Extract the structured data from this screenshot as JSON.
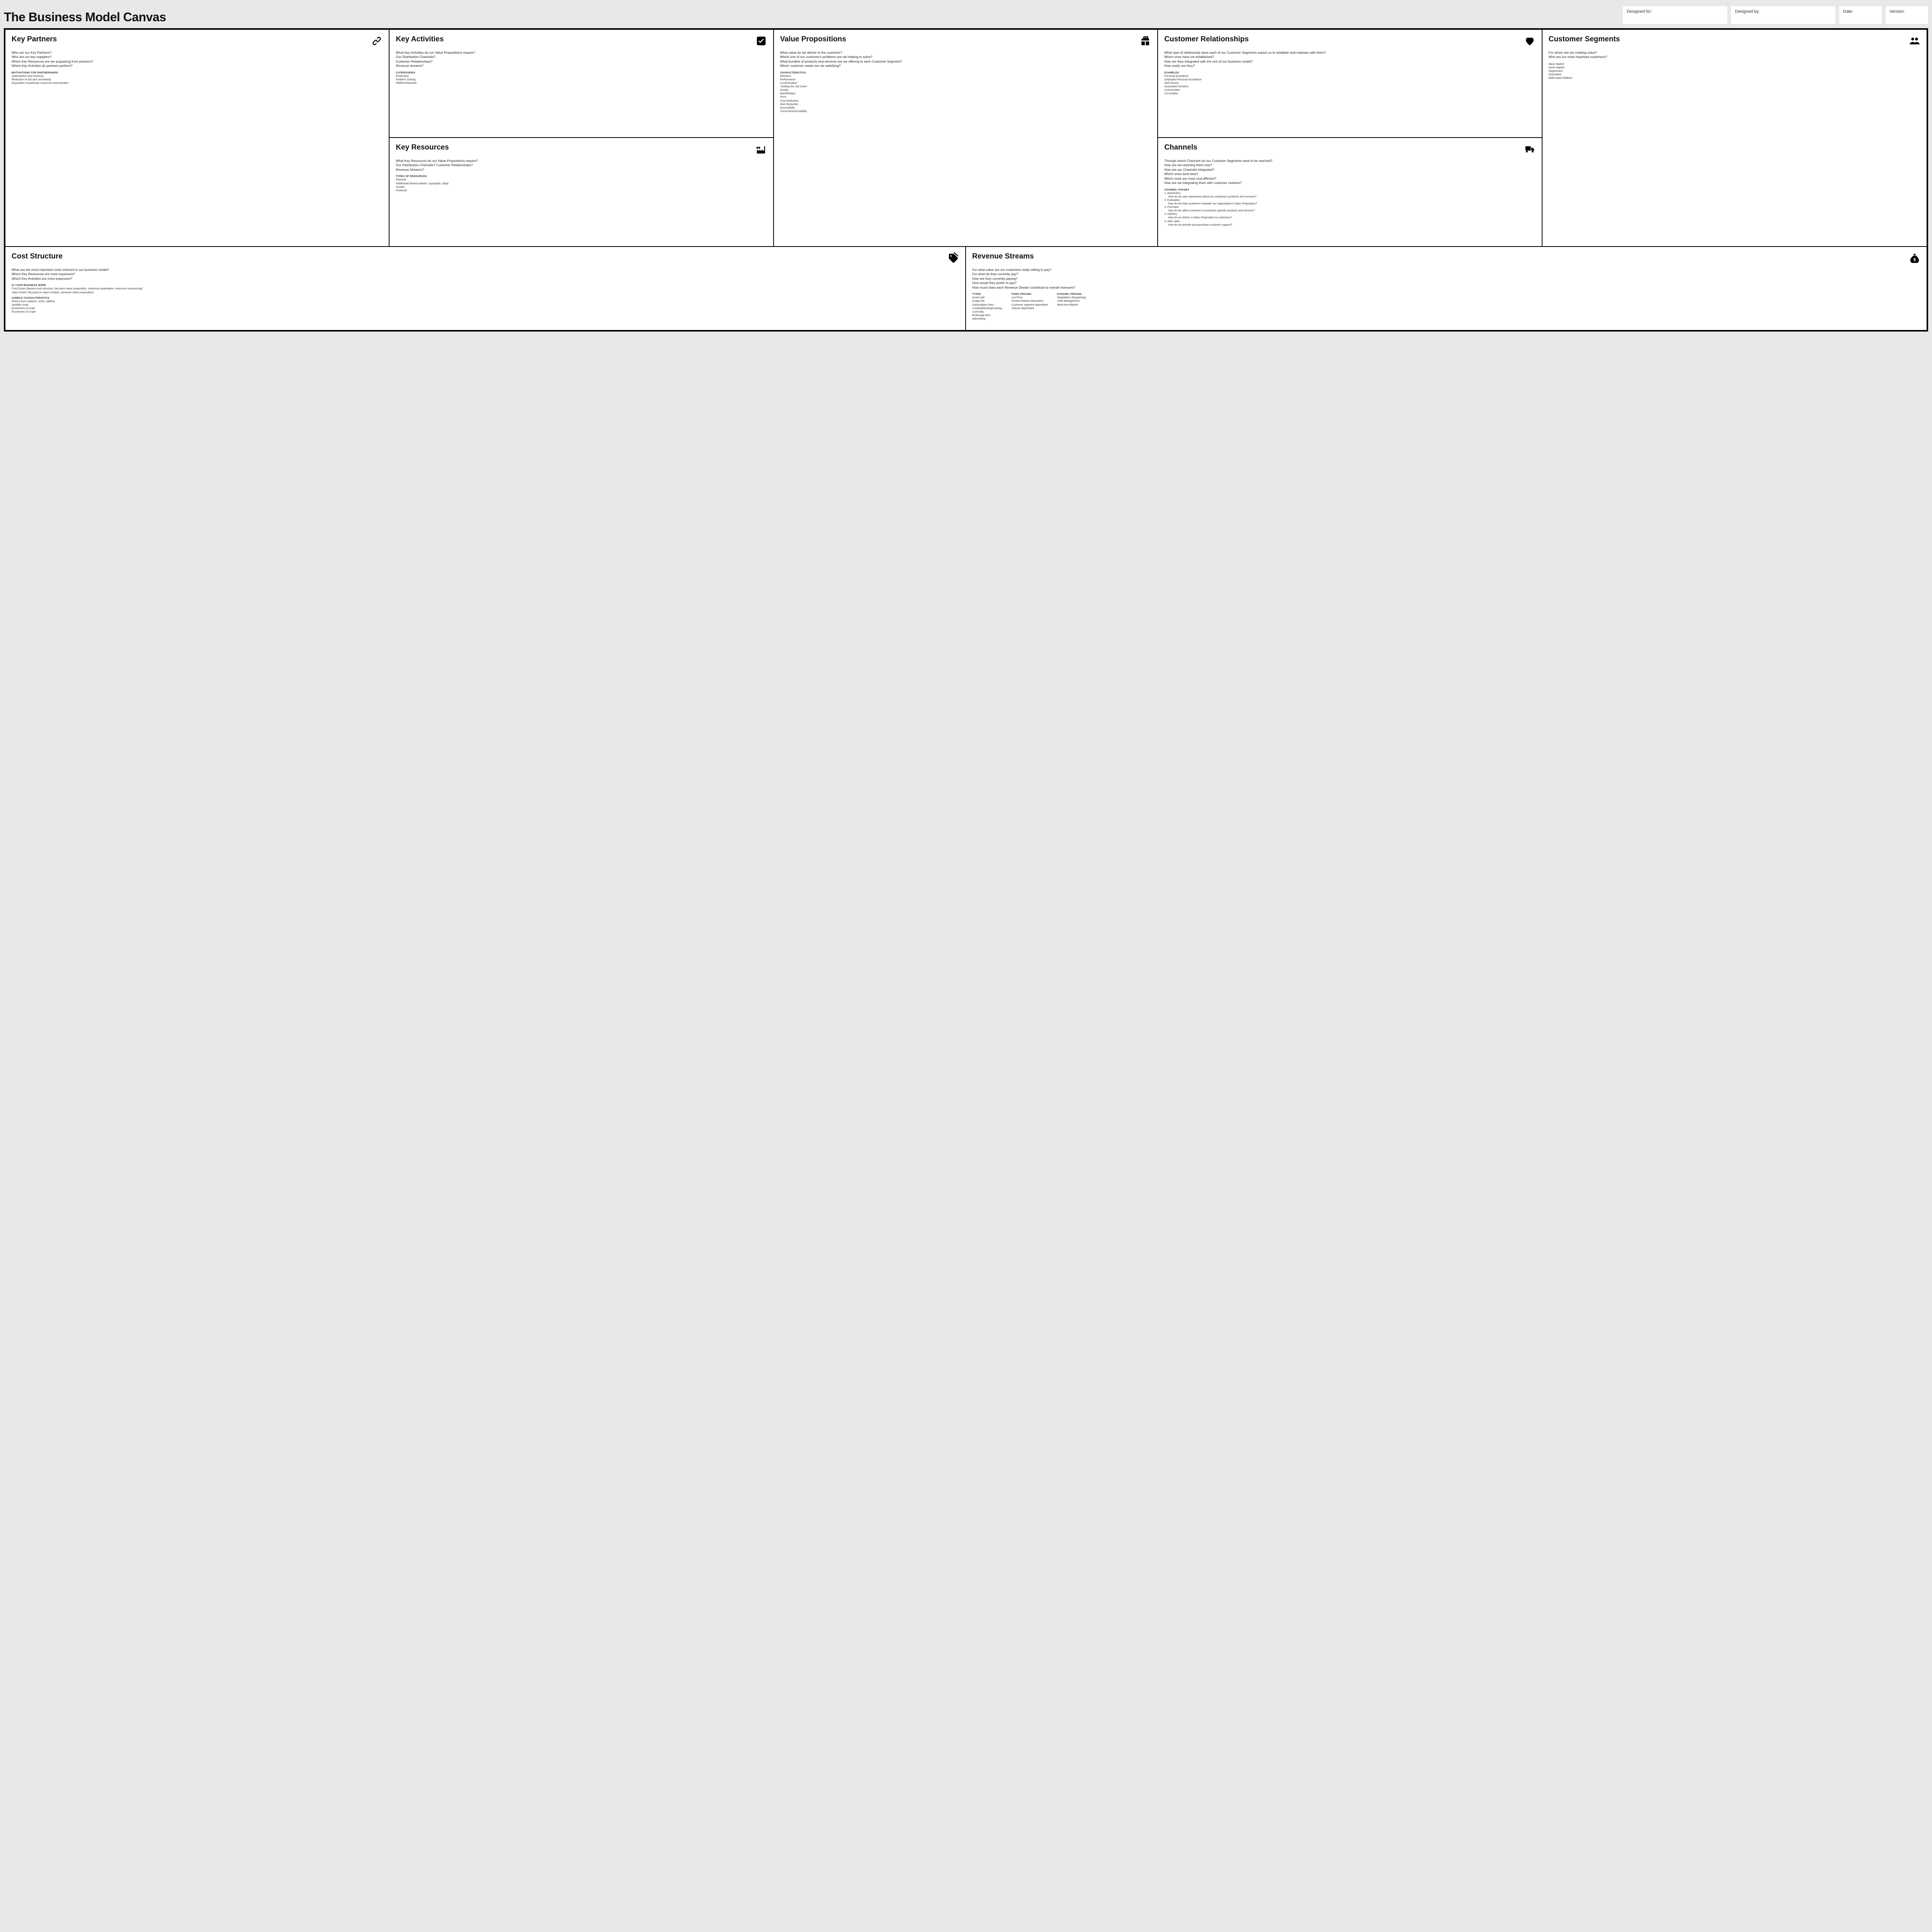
{
  "header": {
    "title": "The Business Model Canvas",
    "designed_for_label": "Designed for:",
    "designed_by_label": "Designed by:",
    "date_label": "Date:",
    "version_label": "Version:"
  },
  "blocks": {
    "key_partners": {
      "title": "Key Partners",
      "prompts": [
        "Who are our Key Partners?",
        "Who are our key suppliers?",
        "Which Key Resources are we acquairing from partners?",
        "Which Key Activities do partners perform?"
      ],
      "sub_head": "motivations for partnerships",
      "sub_items": [
        "Optimization and economy",
        "Reduction of risk and uncertainty",
        "Acquisition of particular resources and activities"
      ]
    },
    "key_activities": {
      "title": "Key Activities",
      "prompts": [
        "What Key Activities do our Value Propositions require?",
        "Our Distribution Channels?",
        "Customer Relationships?",
        "Revenue streams?"
      ],
      "sub_head": "catergories",
      "sub_items": [
        "Production",
        "Problem Solving",
        "Platform/Network"
      ]
    },
    "key_resources": {
      "title": "Key Resources",
      "prompts": [
        "What Key Resources do our Value Propositions require?",
        "Our Distribution Channels? Customer Relationships?",
        "Revenue Streams?"
      ],
      "sub_head": "types of resources",
      "sub_items": [
        "Physical",
        "Intellectual (brand patents, copyrights, data)",
        "Human",
        "Financial"
      ]
    },
    "value_propositions": {
      "title": "Value Propositions",
      "prompts": [
        "What value do we deliver to the customer?",
        "Which one of our customer's problems are we helping to solve?",
        "What bundles of products and services are we offering to each Customer Segment?",
        "Which customer needs are we satisfying?"
      ],
      "sub_head": "characteristics",
      "sub_items": [
        "Newness",
        "Performance",
        "Customization",
        "\"Getting the Job Done\"",
        "Design",
        "Brand/Status",
        "Price",
        "Cost Reduction",
        "Risk Reduction",
        "Accessibility",
        "Convenience/Usability"
      ]
    },
    "customer_relationships": {
      "title": "Customer Relationships",
      "prompts": [
        "What type of relationship does each of our Customer Segments expect us to establish and maintain with them?",
        "Which ones have we established?",
        "How are they integrated with the rest of our business model?",
        "How costly are they?"
      ],
      "sub_head": "examples",
      "sub_items": [
        "Personal assistance",
        "Dedicated Personal Assistance",
        "Self-Service",
        "Automated Services",
        "Communities",
        "Co-creation"
      ]
    },
    "channels": {
      "title": "Channels",
      "prompts": [
        "Through which Channels do our Customer Segments want to be reached?",
        "How are we reaching them now?",
        "How are our Channels integrated?",
        "Which ones work best?",
        "Which ones are most cost-efficient?",
        "How are we integrating them with customer routines?"
      ],
      "sub_head": "channel phases",
      "phases": [
        {
          "label": "1. Awareness",
          "q": "How do we raise awareness about our company's products and services?"
        },
        {
          "label": "2. Evaluation",
          "q": "How do we help customers evaluate our organization's Value Proposition?"
        },
        {
          "label": "3. Purchase",
          "q": "How do we allow customers to purchase specific products and services?"
        },
        {
          "label": "4. Delivery",
          "q": "How do we deliver a Value Proposition to customers?"
        },
        {
          "label": "5. After sales",
          "q": "How do we provide post-purchase customer support?"
        }
      ]
    },
    "customer_segments": {
      "title": "Customer Segments",
      "prompts": [
        "For whom are we creating value?",
        "Who are our most important customers?"
      ],
      "sub_items": [
        "Mass Market",
        "Niche Market",
        "Segmented",
        "Diversified",
        "Multi-sided Platform"
      ]
    },
    "cost_structure": {
      "title": "Cost Structure",
      "prompts": [
        "What are the most important costs inherent in our business model?",
        "Which Key Resources are most expensive?",
        "Which Key Activities are most expensive?"
      ],
      "sub_head1": "is your business more",
      "sub_items1": [
        "Cost Driven (leanest cost structure, low price value proposition, maximum automation, extensive outsourcing)",
        "Value Driven (focused on value creation, premium value proposition)"
      ],
      "sub_head2": "sample characteristics",
      "sub_items2": [
        "Fixed Costs (salaries, rents, utilities)",
        "Variable costs",
        "Economies of scale",
        "Economies of scope"
      ]
    },
    "revenue_streams": {
      "title": "Revenue Streams",
      "prompts": [
        "For what value are our customers really willing to pay?",
        "For what do they currently pay?",
        "How are they currently paying?",
        "How would they prefer to pay?",
        "How much does each Revenue Stream contribute to overall revenues?"
      ],
      "col1_head": "types",
      "col1_items": [
        "Asset sale",
        "Usage fee",
        "Subscription Fees",
        "Lending/Renting/Leasing",
        "Licensing",
        "Brokerage fees",
        "Advertising"
      ],
      "col2_head": "fixed pricing",
      "col2_items": [
        "List Price",
        "Product feature dependent",
        "Customer segment dependent",
        "Volume dependent"
      ],
      "col3_head": "dynamic pricing",
      "col3_items": [
        "Negotiation (bargaining)",
        "Yield Management",
        "Real-time-Market"
      ]
    }
  }
}
